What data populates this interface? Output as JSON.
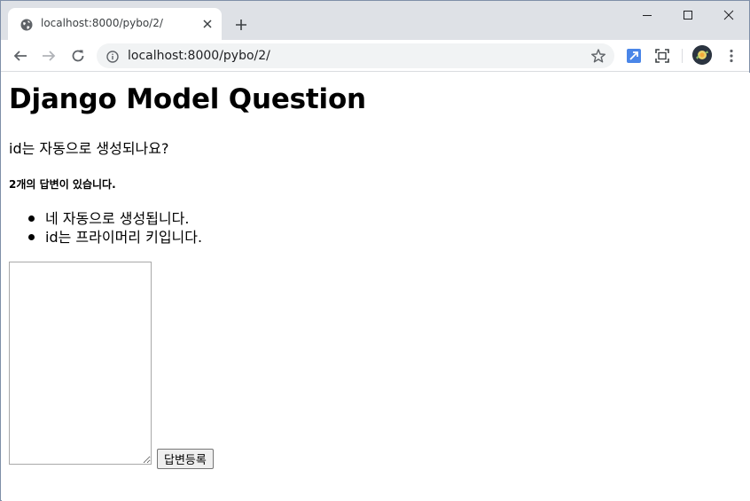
{
  "browser": {
    "tab": {
      "title": "localhost:8000/pybo/2/",
      "favicon": "globe-icon"
    },
    "omnibox": {
      "url": "localhost:8000/pybo/2/"
    }
  },
  "page": {
    "title": "Django Model Question",
    "question": "id는 자동으로 생성되나요?",
    "answer_count": "2개의 답변이 있습니다.",
    "answers": [
      "네 자동으로 생성됩니다.",
      "id는 프라이머리 키입니다."
    ],
    "answer_form": {
      "content_value": "",
      "submit_label": "답변등록"
    }
  },
  "colors": {
    "tabstrip": "#dee1e6",
    "omnibox": "#f1f3f4",
    "icon": "#5f6368",
    "accent": "#1a73e8"
  }
}
